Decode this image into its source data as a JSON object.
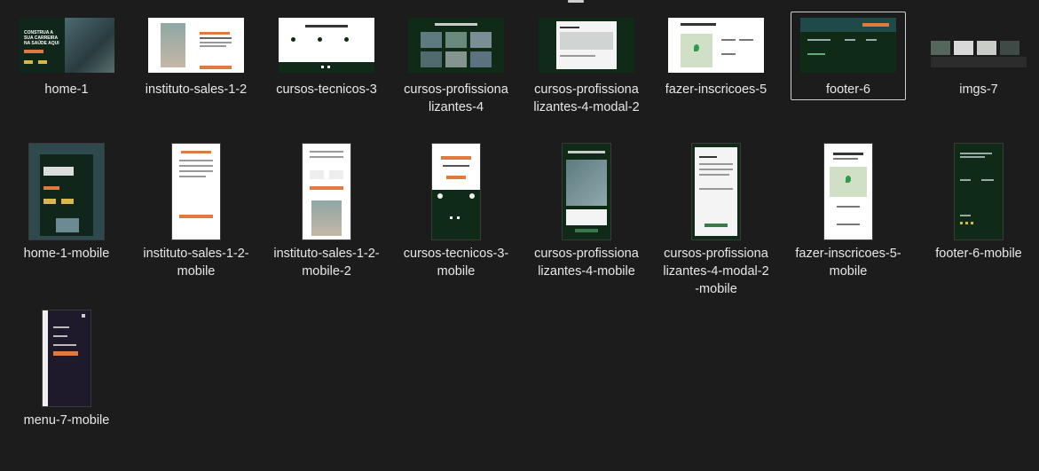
{
  "files": [
    {
      "name": "home-1"
    },
    {
      "name": "instituto-sales-1-2"
    },
    {
      "name": "cursos-tecnicos-3"
    },
    {
      "name": "cursos-profissionalizantes-4"
    },
    {
      "name": "cursos-profissionalizantes-4-modal-2"
    },
    {
      "name": "fazer-inscricoes-5"
    },
    {
      "name": "footer-6"
    },
    {
      "name": "imgs-7"
    },
    {
      "name": "home-1-mobile"
    },
    {
      "name": "instituto-sales-1-2-mobile"
    },
    {
      "name": "instituto-sales-1-2-mobile-2"
    },
    {
      "name": "cursos-tecnicos-3-mobile"
    },
    {
      "name": "cursos-profissionalizantes-4-mobile"
    },
    {
      "name": "cursos-profissionalizantes-4-modal-2-mobile"
    },
    {
      "name": "fazer-inscricoes-5-mobile"
    },
    {
      "name": "footer-6-mobile"
    },
    {
      "name": "menu-7-mobile"
    }
  ],
  "thumb_text": {
    "home_headline": "CONSTRUA A SUA CARREIRA NA SAÚDE AQUI"
  },
  "colors": {
    "background": "#1c1c1c",
    "dark_green": "#0f2a17",
    "accent_orange": "#e07a3e",
    "selection_border": "#cfcfcf"
  }
}
